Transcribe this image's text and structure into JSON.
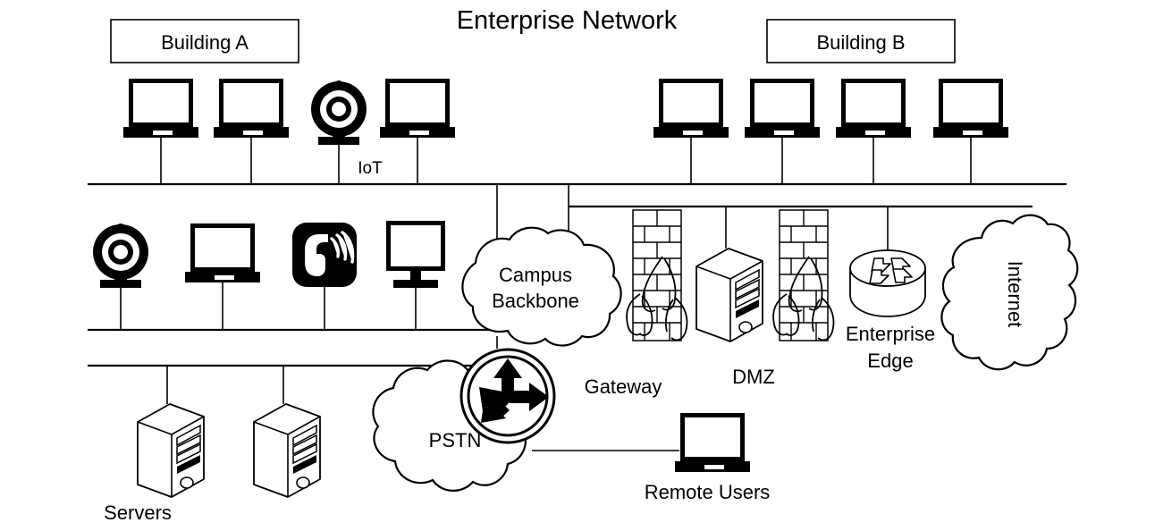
{
  "diagram": {
    "title": "Enterprise Network",
    "type": "network-topology"
  },
  "zones": {
    "building_a": {
      "label": "Building A"
    },
    "building_b": {
      "label": "Building B"
    }
  },
  "labels": {
    "iot": "IoT",
    "campus_backbone": "Campus\nBackbone",
    "campus_backbone_line1": "Campus",
    "campus_backbone_line2": "Backbone",
    "gateway": "Gateway",
    "dmz": "DMZ",
    "enterprise_edge_line1": "Enterprise",
    "enterprise_edge_line2": "Edge",
    "internet": "Internet",
    "servers": "Servers",
    "pstn": "PSTN",
    "remote_users": "Remote Users"
  },
  "nodes": [
    {
      "id": "bldg-a-laptop-1",
      "icon": "laptop-icon",
      "zone": "building_a",
      "label": ""
    },
    {
      "id": "bldg-a-laptop-2",
      "icon": "laptop-icon",
      "zone": "building_a",
      "label": ""
    },
    {
      "id": "bldg-a-webcam",
      "icon": "webcam-icon",
      "zone": "building_a",
      "label": "IoT"
    },
    {
      "id": "bldg-a-laptop-3",
      "icon": "laptop-icon",
      "zone": "building_a",
      "label": ""
    },
    {
      "id": "bldg-b-laptop-1",
      "icon": "laptop-icon",
      "zone": "building_b",
      "label": ""
    },
    {
      "id": "bldg-b-laptop-2",
      "icon": "laptop-icon",
      "zone": "building_b",
      "label": ""
    },
    {
      "id": "bldg-b-laptop-3",
      "icon": "laptop-icon",
      "zone": "building_b",
      "label": ""
    },
    {
      "id": "bldg-b-laptop-4",
      "icon": "laptop-icon",
      "zone": "building_b",
      "label": ""
    },
    {
      "id": "row2-webcam",
      "icon": "webcam-icon",
      "zone": "campus",
      "label": ""
    },
    {
      "id": "row2-laptop",
      "icon": "laptop-icon",
      "zone": "campus",
      "label": ""
    },
    {
      "id": "row2-ip-phone",
      "icon": "ip-phone-icon",
      "zone": "campus",
      "label": ""
    },
    {
      "id": "row2-desktop",
      "icon": "desktop-monitor-icon",
      "zone": "campus",
      "label": ""
    },
    {
      "id": "campus-backbone",
      "icon": "cloud-icon",
      "zone": "core",
      "label": "Campus Backbone"
    },
    {
      "id": "gateway-firewall",
      "icon": "firewall-icon",
      "zone": "edge",
      "label": "Gateway"
    },
    {
      "id": "dmz-server",
      "icon": "server-tower-icon",
      "zone": "edge",
      "label": "DMZ"
    },
    {
      "id": "dmz-firewall",
      "icon": "firewall-icon",
      "zone": "edge",
      "label": ""
    },
    {
      "id": "enterprise-edge-router",
      "icon": "router-icon",
      "zone": "edge",
      "label": "Enterprise Edge"
    },
    {
      "id": "internet-cloud",
      "icon": "cloud-icon",
      "zone": "external",
      "label": "Internet"
    },
    {
      "id": "server-1",
      "icon": "server-tower-icon",
      "zone": "datacenter",
      "label": "Servers"
    },
    {
      "id": "server-2",
      "icon": "server-tower-icon",
      "zone": "datacenter",
      "label": ""
    },
    {
      "id": "voice-router",
      "icon": "router-multidirectional-icon",
      "zone": "voice",
      "label": ""
    },
    {
      "id": "pstn-cloud",
      "icon": "cloud-icon",
      "zone": "voice",
      "label": "PSTN"
    },
    {
      "id": "remote-user-laptop",
      "icon": "laptop-icon",
      "zone": "remote",
      "label": "Remote Users"
    }
  ]
}
